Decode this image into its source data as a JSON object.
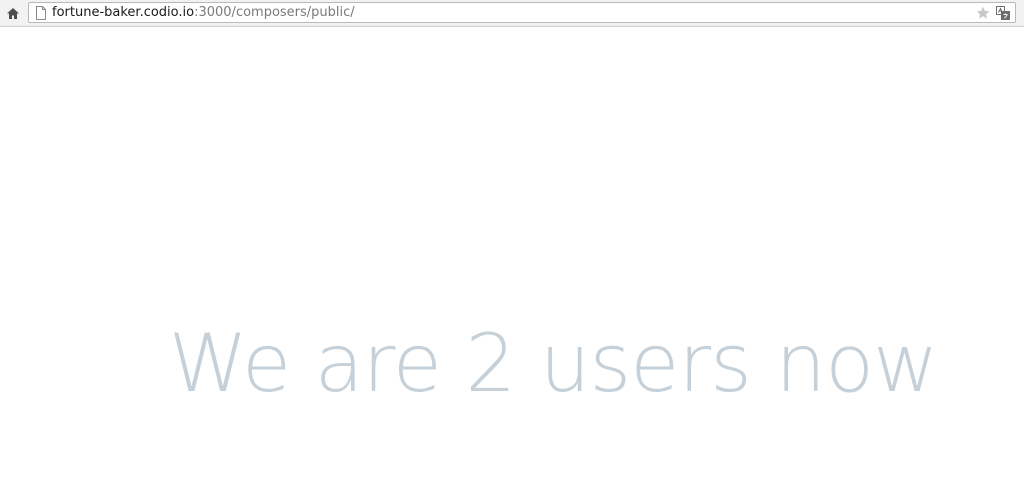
{
  "browser": {
    "url_host": "fortune-baker.codio.io",
    "url_rest": ":3000/composers/public/",
    "icons": {
      "home": "home-icon",
      "page": "page-icon",
      "bookmark": "star-icon",
      "translate": "translate-icon"
    }
  },
  "page": {
    "headline": "We are 2 users now",
    "headline_color": "#c5d0d8"
  }
}
